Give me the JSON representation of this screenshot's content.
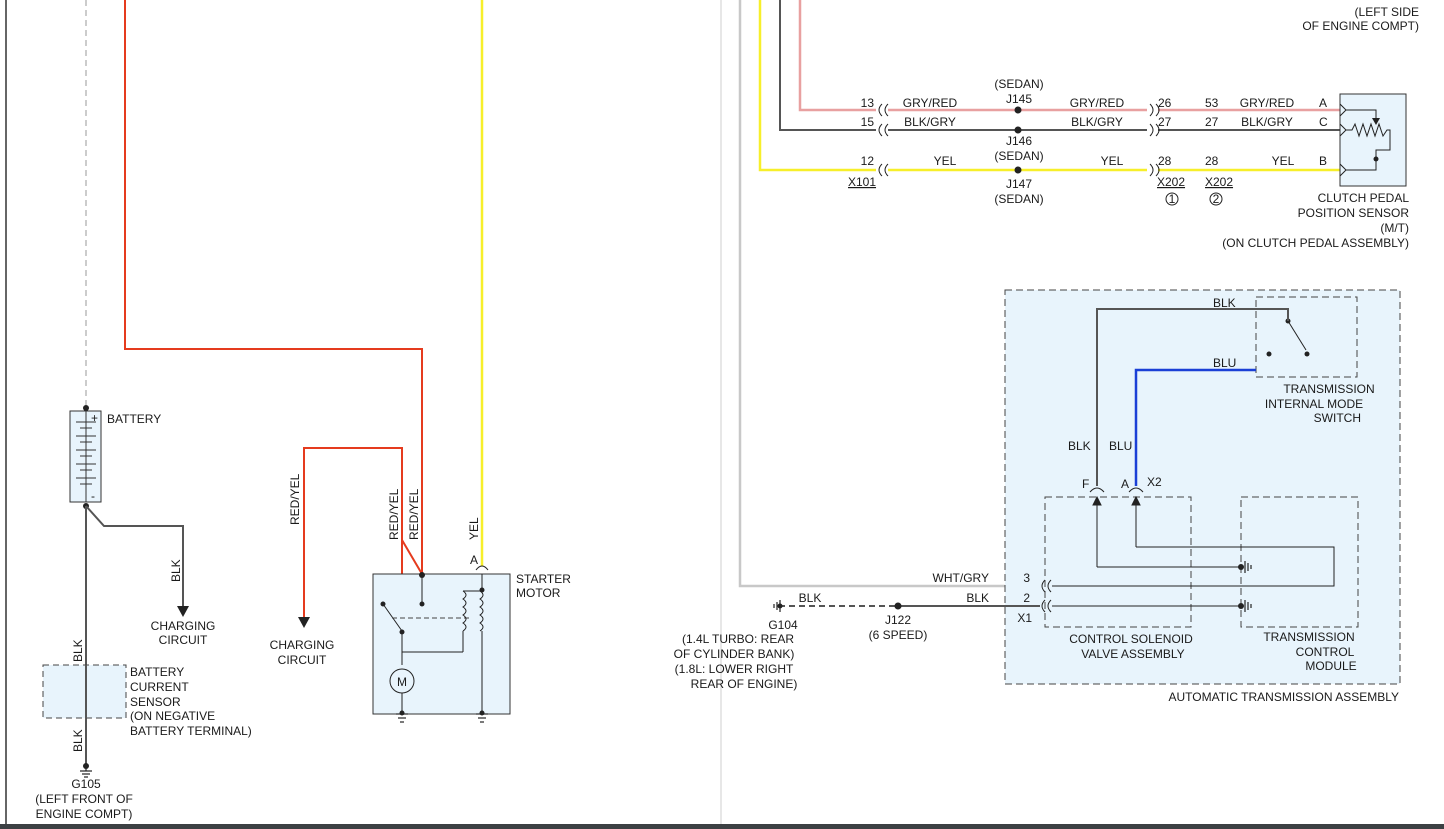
{
  "colors": {
    "red": "#e53b1e",
    "yellow": "#f7ef2a",
    "gray": "#555555",
    "pink": "#e8a0a0",
    "blue": "#1a3fd6",
    "lightgray": "#c8c8c8",
    "box_fill": "#e8f4fc"
  },
  "top_right": {
    "line1": "(LEFT SIDE",
    "line2": "OF ENGINE COMPT)"
  },
  "battery": {
    "label": "BATTERY",
    "plus": "+",
    "minus": "-",
    "wire_blk": "BLK",
    "charging": [
      "CHARGING",
      "CIRCUIT"
    ]
  },
  "current_sensor": {
    "lines": [
      "BATTERY",
      "CURRENT",
      "SENSOR",
      "(ON NEGATIVE",
      "BATTERY TERMINAL)"
    ],
    "wire_top": "BLK",
    "wire_bottom": "BLK"
  },
  "g105": {
    "id": "G105",
    "lines": [
      "(LEFT FRONT OF",
      "ENGINE COMPT)"
    ]
  },
  "starter": {
    "lines": [
      "STARTER",
      "MOTOR"
    ],
    "wire1": "RED/YEL",
    "wire2": "RED/YEL",
    "wire3": "RED/YEL",
    "wire_yel": "YEL",
    "pin_a": "A",
    "motor_letter": "M",
    "charging": [
      "CHARGING",
      "CIRCUIT"
    ]
  },
  "clutch_circuit": {
    "rows": [
      {
        "pin_x101": "13",
        "wire1": "GRY/RED",
        "splice": "J145",
        "wire2": "GRY/RED",
        "pin_x202_1": "26",
        "pin_x202_2": "53",
        "wire3": "GRY/RED",
        "sensor_pin": "A"
      },
      {
        "pin_x101": "15",
        "wire1": "BLK/GRY",
        "splice": "J146",
        "wire2": "BLK/GRY",
        "pin_x202_1": "27",
        "pin_x202_2": "27",
        "wire3": "BLK/GRY",
        "sensor_pin": "C"
      },
      {
        "pin_x101": "12",
        "wire1": "YEL",
        "splice": "J147",
        "wire2": "YEL",
        "pin_x202_1": "28",
        "pin_x202_2": "28",
        "wire3": "YEL",
        "sensor_pin": "B"
      }
    ],
    "sedan": "(SEDAN)",
    "x101": "X101",
    "x202": "X202",
    "circle1": "1",
    "circle2": "2",
    "sensor_lines": [
      "CLUTCH PEDAL",
      "POSITION SENSOR",
      "(M/T)",
      "(ON CLUTCH PEDAL ASSEMBLY)"
    ]
  },
  "trans": {
    "assembly_label": "AUTOMATIC TRANSMISSION ASSEMBLY",
    "switch_lines": [
      "TRANSMISSION",
      "INTERNAL MODE",
      "SWITCH"
    ],
    "wire_blk": "BLK",
    "wire_blu": "BLU",
    "pin_f": "F",
    "pin_a": "A",
    "conn_x2": "X2",
    "conn_x1": "X1",
    "pin_3": "3",
    "pin_2": "2",
    "wire_whtgry": "WHT/GRY",
    "wire_blk2": "BLK",
    "solenoid_lines": [
      "CONTROL SOLENOID",
      "VALVE ASSEMBLY"
    ],
    "tcm_lines": [
      "TRANSMISSION",
      "CONTROL",
      "MODULE"
    ]
  },
  "g104": {
    "id": "G104",
    "wire": "BLK",
    "lines": [
      "(1.4L TURBO: REAR",
      "OF CYLINDER BANK)",
      "(1.8L: LOWER RIGHT",
      "REAR OF ENGINE)"
    ]
  },
  "j122": {
    "id": "J122",
    "note": "(6 SPEED)"
  }
}
